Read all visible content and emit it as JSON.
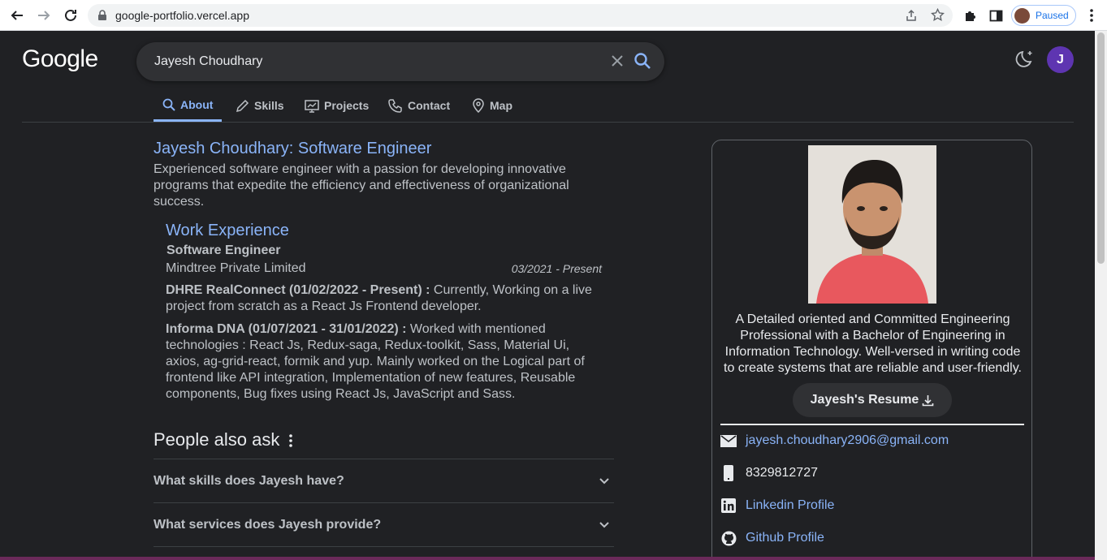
{
  "browser": {
    "url": "google-portfolio.vercel.app",
    "profile_status": "Paused"
  },
  "header": {
    "logo": "Google",
    "search_value": "Jayesh Choudhary",
    "avatar_letter": "J"
  },
  "tabs": [
    {
      "label": "About",
      "icon": "search-icon",
      "active": true
    },
    {
      "label": "Skills",
      "icon": "pencil-icon"
    },
    {
      "label": "Projects",
      "icon": "presentation-icon"
    },
    {
      "label": "Contact",
      "icon": "phone-icon"
    },
    {
      "label": "Map",
      "icon": "map-pin-icon"
    }
  ],
  "about": {
    "title": "Jayesh Choudhary: Software Engineer",
    "summary": "Experienced software engineer with a passion for developing innovative programs that expedite the efficiency and effectiveness of organizational success."
  },
  "work": {
    "heading": "Work Experience",
    "role": "Software Engineer",
    "company": "Mindtree Private Limited",
    "period": "03/2021 - Present",
    "projects": [
      {
        "name": "DHRE RealConnect (01/02/2022 - Present) :",
        "desc": " Currently, Working on a live project from scratch as a React Js Frontend developer."
      },
      {
        "name": "Informa DNA (01/07/2021 - 31/01/2022) :",
        "desc": " Worked with mentioned technologies : React Js, Redux-saga, Redux-toolkit, Sass, Material Ui, axios, ag-grid-react, formik and yup. Mainly worked on the Logical part of frontend like API integration, Implementation of new features, Reusable components, Bug fixes using React Js, JavaScript and Sass."
      }
    ]
  },
  "people_also_ask": {
    "title": "People also ask",
    "questions": [
      "What skills does Jayesh have?",
      "What services does Jayesh provide?"
    ]
  },
  "profile": {
    "bio": "A Detailed oriented and Committed Engineering Professional with a Bachelor of Engineering in Information Technology. Well-versed in writing code to create systems that are reliable and user-friendly.",
    "resume_button": "Jayesh's Resume",
    "email": "jayesh.choudhary2906@gmail.com",
    "phone": "8329812727",
    "linkedin": "Linkedin Profile",
    "github": "Github Profile"
  },
  "colors": {
    "link": "#8ab4f8",
    "background": "#202124",
    "avatar": "#5e35b1"
  }
}
